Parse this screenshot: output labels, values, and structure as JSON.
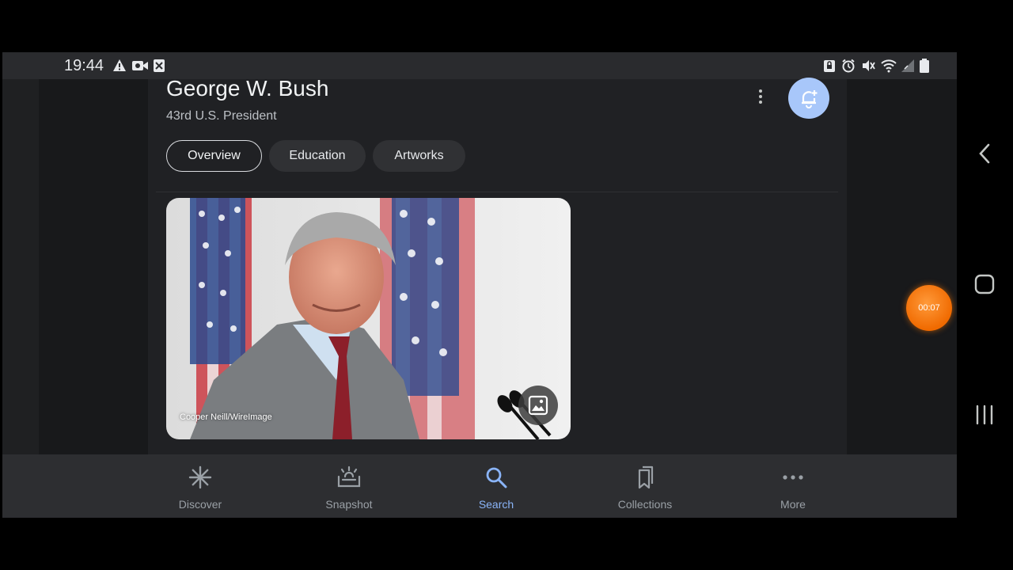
{
  "status_bar": {
    "time": "19:44",
    "left_icons": [
      "warning-icon",
      "video-camera-icon",
      "close-box-icon"
    ],
    "right_icons": [
      "lock-rotation-icon",
      "alarm-icon",
      "mute-icon",
      "wifi-icon",
      "signal-icon",
      "battery-icon"
    ]
  },
  "header": {
    "title": "George W. Bush",
    "subtitle": "43rd U.S. President",
    "more_icon": "more-vert-icon",
    "follow_icon": "add-notification-icon",
    "follow_color": "#a8c7fa"
  },
  "tabs": [
    {
      "label": "Overview",
      "active": true
    },
    {
      "label": "Education",
      "active": false
    },
    {
      "label": "Artworks",
      "active": false
    }
  ],
  "image_card": {
    "credit": "Cooper Neill/WireImage",
    "action_icon": "image-icon"
  },
  "bottom_nav": {
    "items": [
      {
        "label": "Discover",
        "icon": "asterisk-icon",
        "active": false
      },
      {
        "label": "Snapshot",
        "icon": "snapshot-icon",
        "active": false
      },
      {
        "label": "Search",
        "icon": "search-icon",
        "active": true
      },
      {
        "label": "Collections",
        "icon": "bookmarks-icon",
        "active": false
      },
      {
        "label": "More",
        "icon": "more-horiz-icon",
        "active": false
      }
    ],
    "active_color": "#8ab4f8"
  },
  "system_nav": {
    "icons": [
      "back-icon",
      "home-icon",
      "recents-icon"
    ]
  },
  "recorder": {
    "elapsed": "00:07",
    "color": "#f57c00"
  }
}
